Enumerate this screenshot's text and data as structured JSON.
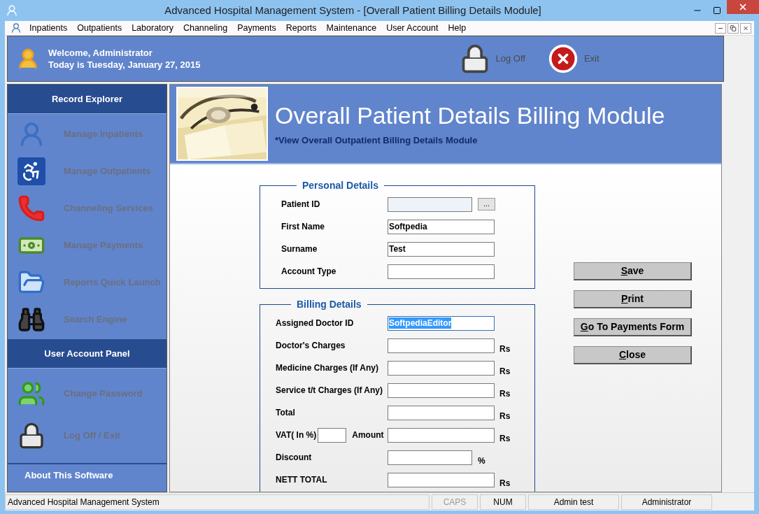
{
  "window": {
    "title": "Advanced Hospital Management System - [Overall Patient Billing Details Module]"
  },
  "menu": [
    "Inpatients",
    "Outpatients",
    "Laboratory",
    "Channeling",
    "Payments",
    "Reports",
    "Maintenance",
    "User Account",
    "Help"
  ],
  "header": {
    "welcome": "Welcome, Administrator",
    "date": "Today is Tuesday, January 27, 2015",
    "actions": [
      {
        "kind": "logoff",
        "label": "Log Off"
      },
      {
        "kind": "exit",
        "label": "Exit"
      }
    ]
  },
  "sidebar": {
    "sections": [
      {
        "title": "Record Explorer",
        "items": [
          {
            "kind": "inpatients",
            "label": "Manage Inpatients",
            "disabled": true
          },
          {
            "kind": "outpatients",
            "label": "Manage Outpatients",
            "disabled": true
          },
          {
            "kind": "channeling",
            "label": "Channeling Services",
            "disabled": true
          },
          {
            "kind": "payments",
            "label": "Manage Payments",
            "disabled": true
          },
          {
            "kind": "reports",
            "label": "Reports Quick Launch",
            "disabled": true
          },
          {
            "kind": "search",
            "label": "Search Engine",
            "disabled": true
          }
        ]
      },
      {
        "title": "User Account Panel",
        "items": [
          {
            "kind": "password",
            "label": "Change Password",
            "disabled": true
          },
          {
            "kind": "logoff",
            "label": "Log Off / Exit",
            "disabled": true
          }
        ]
      },
      {
        "title": "About This Software"
      }
    ]
  },
  "banner": {
    "title": "Overall Patient Details Billing Module",
    "subtitle": "*View Overall Outpatient Billing Details Module"
  },
  "personal_details": {
    "title": "Personal Details",
    "fields": [
      {
        "kind": "lookup",
        "label": "Patient ID",
        "button": "...",
        "disabled": true,
        "highlighted": false
      },
      {
        "kind": "text",
        "label": "First Name",
        "value": "Softpedia",
        "disabled": false,
        "highlighted": false
      },
      {
        "kind": "text",
        "label": "Surname",
        "value": "Test",
        "disabled": false,
        "highlighted": false
      },
      {
        "kind": "text",
        "label": "Account Type",
        "disabled": false,
        "highlighted": false
      }
    ]
  },
  "billing_details": {
    "title": "Billing Details",
    "fields": [
      {
        "kind": "text",
        "label": "Assigned Doctor ID",
        "value": "SoftpediaEditor",
        "disabled": false,
        "highlighted": true
      },
      {
        "kind": "text",
        "label": "Doctor's Charges",
        "unit": "Rs",
        "disabled": false,
        "highlighted": false
      },
      {
        "kind": "text",
        "label": "Medicine Charges (If Any)",
        "unit": "Rs",
        "disabled": false,
        "highlighted": false
      },
      {
        "kind": "text",
        "label": "Service t/t Charges (If Any)",
        "unit": "Rs",
        "disabled": false,
        "highlighted": false
      },
      {
        "kind": "text",
        "label": "Total",
        "unit": "Rs",
        "disabled": false,
        "highlighted": false
      },
      {
        "kind": "vat",
        "label": "VAT( In %)",
        "amount_label": "Amount",
        "unit": "Rs",
        "disabled": false,
        "highlighted": false
      },
      {
        "kind": "short",
        "label": "Discount",
        "unit": "%",
        "disabled": false,
        "highlighted": false
      },
      {
        "kind": "text",
        "label": "NETT TOTAL",
        "unit": "Rs",
        "disabled": false,
        "highlighted": false
      }
    ]
  },
  "buttons": [
    {
      "label": "Save"
    },
    {
      "label": "Print"
    },
    {
      "label": "Go To Payments Form"
    },
    {
      "label": "Close"
    }
  ],
  "status_bar": [
    {
      "text": "Advanced Hospital Management System",
      "disabled": false
    },
    {
      "text": "CAPS",
      "disabled": true
    },
    {
      "text": "NUM",
      "disabled": false
    },
    {
      "text": "Admin test",
      "disabled": false
    },
    {
      "text": "Administrator",
      "disabled": false
    }
  ]
}
